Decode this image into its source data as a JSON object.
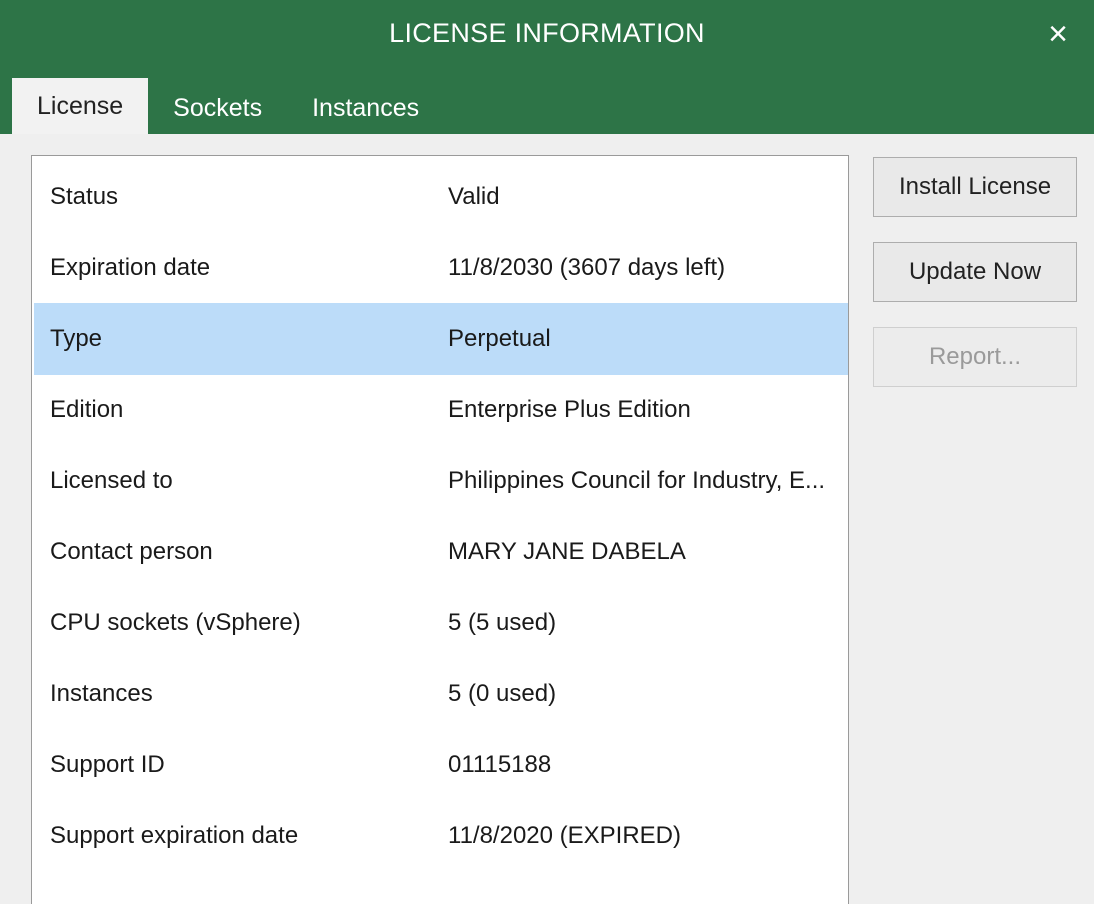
{
  "window": {
    "title": "LICENSE INFORMATION",
    "close_label": "×"
  },
  "tabs": [
    {
      "label": "License",
      "active": true
    },
    {
      "label": "Sockets",
      "active": false
    },
    {
      "label": "Instances",
      "active": false
    }
  ],
  "license_info": {
    "rows": [
      {
        "label": "Status",
        "value": "Valid"
      },
      {
        "label": "Expiration date",
        "value": "11/8/2030 (3607 days left)"
      },
      {
        "label": "Type",
        "value": "Perpetual",
        "selected": true
      },
      {
        "label": "Edition",
        "value": "Enterprise Plus Edition"
      },
      {
        "label": "Licensed to",
        "value": "Philippines Council for Industry, E..."
      },
      {
        "label": "Contact person",
        "value": "MARY JANE DABELA"
      },
      {
        "label": "CPU sockets (vSphere)",
        "value": "5 (5 used)"
      },
      {
        "label": "Instances",
        "value": "5 (0 used)"
      },
      {
        "label": "Support ID",
        "value": "01115188"
      },
      {
        "label": "Support expiration date",
        "value": "11/8/2020 (EXPIRED)"
      }
    ]
  },
  "buttons": {
    "install_license": "Install License",
    "update_now": "Update Now",
    "report": "Report..."
  },
  "colors": {
    "titlebar": "#2d7447",
    "selected_row": "#bcdcf9"
  },
  "icons": {
    "close": "close-icon"
  }
}
